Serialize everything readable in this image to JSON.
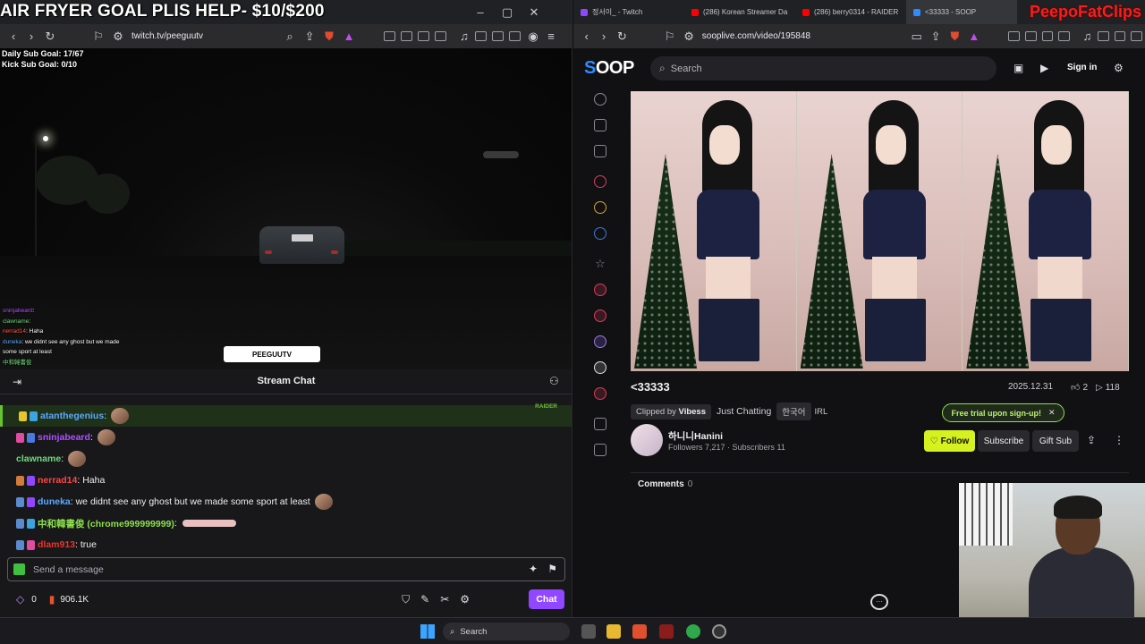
{
  "left_browser": {
    "url": "twitch.tv/peeguutv",
    "stream_overlay": {
      "title": "AIR FRYER GOAL PLIS HELP- $10/$200",
      "goal_line1": "Daily Sub Goal: 17/67",
      "goal_line2": "Kick Sub Goal: 0/10",
      "overlay_logo": "PEEGUUTV",
      "overlay_chat": [
        {
          "user": "sninjabeard",
          "text": ":"
        },
        {
          "user": "clawname",
          "text": ":"
        },
        {
          "user": "nerrad14",
          "text": ": Haha"
        },
        {
          "user": "duneka",
          "text": ": we didnt see any ghost but we made"
        },
        {
          "user": "",
          "text": "some sport at least"
        },
        {
          "user": "中和韓書俊",
          "text": ""
        }
      ]
    },
    "chat": {
      "title": "Stream Chat",
      "raider_tag": "RAIDER",
      "messages": [
        {
          "user": "atanthegenius",
          "text": "",
          "color": "#5aa9ff"
        },
        {
          "user": "sninjabeard",
          "text": "",
          "color": "#b050ff"
        },
        {
          "user": "clawname",
          "text": "",
          "color": "#6eda77"
        },
        {
          "user": "nerrad14",
          "text": ": Haha",
          "color": "#ff4545"
        },
        {
          "user": "duneka",
          "text": ": we didnt see any ghost but we made some sport at least",
          "color": "#5aa9ff"
        },
        {
          "user": "中和韓書俊 (chrome999999999)",
          "text": ":",
          "color": "#8de04a"
        },
        {
          "user": "dlam913",
          "text": ": true",
          "color": "#e8352e"
        }
      ],
      "input_placeholder": "Send a message",
      "points": "0",
      "bits": "906.1K",
      "chat_button": "Chat"
    }
  },
  "right_browser": {
    "tabs": [
      {
        "label": "정서이_ - Twitch",
        "color": "#9147ff"
      },
      {
        "label": "(286) Korean Streamer Da",
        "color": "#ff0000"
      },
      {
        "label": "(286) berry0314 - RAIDER",
        "color": "#ff0000"
      },
      {
        "label": "<33333 - SOOP",
        "color": "#2f8bff"
      }
    ],
    "url": "sooplive.com/video/195848",
    "watermark": "PeepoFatClips",
    "site": {
      "logo_a": "S",
      "logo_b": "OOP",
      "search_placeholder": "Search",
      "sign_in": "Sign in"
    },
    "video": {
      "title": "<33333",
      "date": "2025.12.31",
      "likes": "2",
      "views": "118",
      "clipped_by_label": "Clipped by",
      "clipped_by": "Vibess",
      "category": "Just Chatting",
      "tags": [
        "한국어",
        "IRL"
      ],
      "trial_text": "Free trial upon sign-up!",
      "channel_name": "하니니Hanini",
      "channel_stats": "Followers 7,217 · Subscribers 11",
      "follow": "Follow",
      "subscribe": "Subscribe",
      "gift_sub": "Gift Sub",
      "comments_label": "Comments",
      "comments_count": "0"
    }
  },
  "taskbar": {
    "search": "Search"
  }
}
